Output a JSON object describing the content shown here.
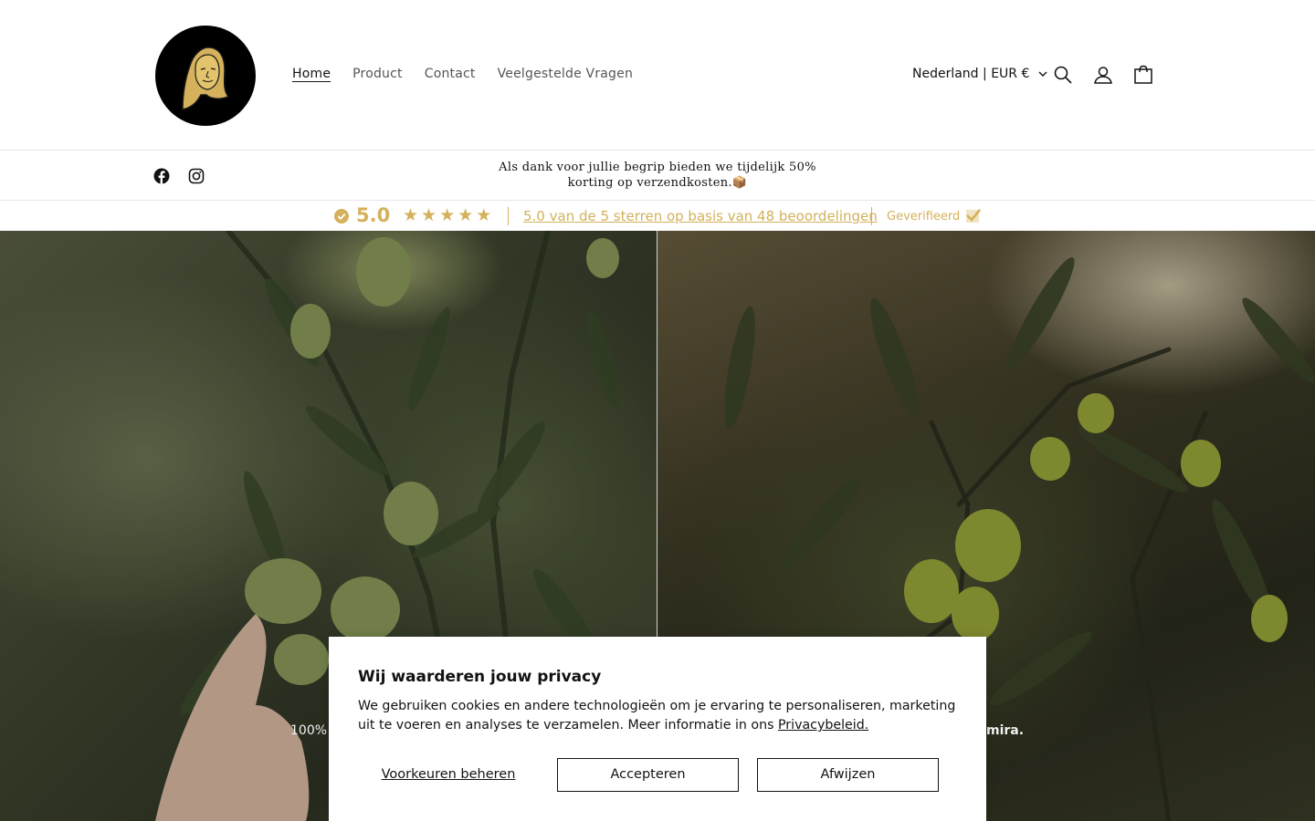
{
  "header": {
    "nav": [
      {
        "label": "Home",
        "active": true
      },
      {
        "label": "Product",
        "active": false
      },
      {
        "label": "Contact",
        "active": false
      },
      {
        "label": "Veelgestelde Vragen",
        "active": false
      }
    ],
    "country_selector": "Nederland | EUR €",
    "icons": [
      "search-icon",
      "account-icon",
      "cart-icon"
    ]
  },
  "announcement": {
    "social_icons": [
      "facebook-icon",
      "instagram-icon"
    ],
    "text": "Als dank voor jullie begrip bieden we tijdelijk 50% korting op verzendkosten.📦"
  },
  "reviews": {
    "score": "5.0",
    "stars": 5,
    "summary_link": "5.0 van de 5 sterren op basis van 48 beoordelingen",
    "verified_label": "Geverifieerd",
    "accent_color": "#d4b15a"
  },
  "hero": {
    "caption_left": "100%",
    "caption_right": "mira."
  },
  "cookie_banner": {
    "title": "Wij waarderen jouw privacy",
    "body": "We gebruiken cookies en andere technologieën om je ervaring te personaliseren, marketing uit te voeren en analyses te verzamelen. Meer informatie in ons ",
    "privacy_link": "Privacybeleid.",
    "prefs_button": "Voorkeuren beheren",
    "accept_button": "Accepteren",
    "reject_button": "Afwijzen"
  }
}
